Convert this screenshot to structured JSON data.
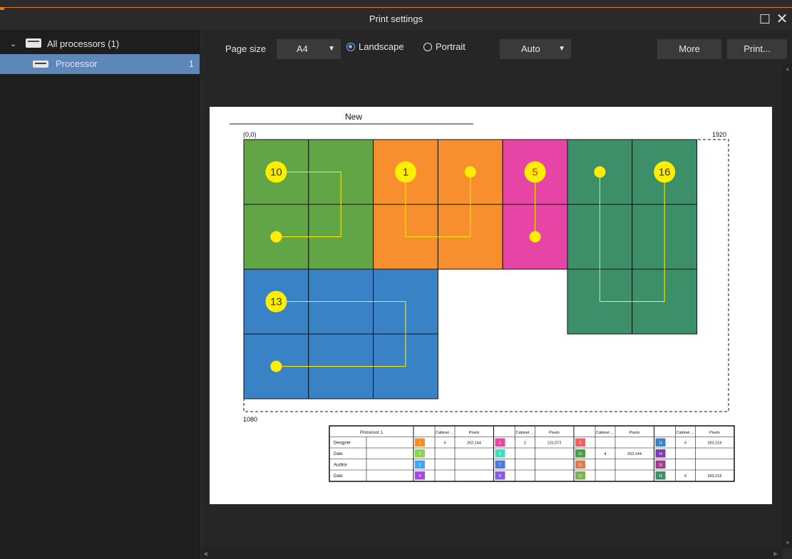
{
  "window": {
    "title": "Print settings"
  },
  "sidebar": {
    "items": [
      {
        "label": "All processors (1)",
        "count": ""
      },
      {
        "label": "Processor",
        "count": "1"
      }
    ]
  },
  "toolbar": {
    "page_size_label": "Page size",
    "page_size_value": "A4",
    "orientation_landscape": "Landscape",
    "orientation_portrait": "Portrait",
    "orientation_selected": "Landscape",
    "scale_value": "Auto",
    "more_label": "More",
    "print_label": "Print..."
  },
  "preview": {
    "title": "New",
    "origin_label": "(0,0)",
    "width_label": "1920",
    "height_label": "1080",
    "colors": {
      "green": "#62a547",
      "orange": "#f78f2e",
      "pink": "#e645a6",
      "teal": "#3d8f6a",
      "blue": "#3a82c6",
      "dot": "#ffee00"
    },
    "groups": [
      {
        "color": "green",
        "start_label": "10"
      },
      {
        "color": "orange",
        "start_label": "1"
      },
      {
        "color": "pink",
        "start_label": "5"
      },
      {
        "color": "teal",
        "start_label": "16"
      },
      {
        "color": "blue",
        "start_label": "13"
      }
    ]
  },
  "legend": {
    "processor": "Processor 1",
    "rows": [
      "Designer",
      "Date",
      "Auditor",
      "Date"
    ],
    "header_cabinet": "Cabinet ...",
    "header_pixels": "Pixels",
    "blocks": [
      {
        "ports": [
          "1",
          "2",
          "3",
          "4"
        ],
        "colors": [
          "#f78f2e",
          "#8bd34a",
          "#3fa8f0",
          "#a64ae0"
        ],
        "cabinets": "4",
        "pixels": "262,144"
      },
      {
        "ports": [
          "5",
          "6",
          "7",
          "8"
        ],
        "colors": [
          "#e645a6",
          "#3fe0c0",
          "#4a7ae0",
          "#8a5ae0"
        ],
        "cabinets": "2",
        "pixels": "131,072"
      },
      {
        "ports": [
          "9",
          "10",
          "11",
          "12"
        ],
        "colors": [
          "#f06060",
          "#4a9e46",
          "#e07a4a",
          "#7ab04a"
        ],
        "cabinets": "4",
        "pixels": "262,144"
      },
      {
        "ports": [
          "13",
          "14",
          "15",
          "16"
        ],
        "colors": [
          "#3a82c6",
          "#7a3ab0",
          "#a03a90",
          "#3d8f6a"
        ],
        "cabinets": "6",
        "pixels": "393,216"
      }
    ],
    "extra_row": {
      "cabinets": "6",
      "pixels": "393,216"
    }
  }
}
